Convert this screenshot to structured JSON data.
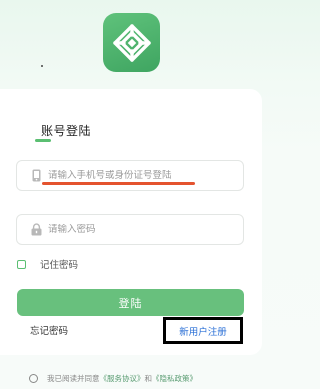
{
  "login": {
    "tab_title": "账号登陆",
    "account_placeholder": "请输入手机号或身份证号登陆",
    "password_placeholder": "请输入密码",
    "remember_label": "记住密码",
    "login_button": "登陆",
    "forgot_link": "忘记密码",
    "register_link": "新用户注册"
  },
  "agreement": {
    "prefix": "我已阅读并同意",
    "service_link": "《服务协议》",
    "conjunction": "和",
    "privacy_link": "《隐私政策》"
  },
  "colors": {
    "brand_green": "#5bbf72",
    "button_green": "#68c07d",
    "link_blue": "#2a6fd6",
    "annotation_red": "#e4532f"
  },
  "icons": {
    "logo": "app-logo-icon",
    "account": "phone-icon",
    "password": "lock-icon"
  }
}
